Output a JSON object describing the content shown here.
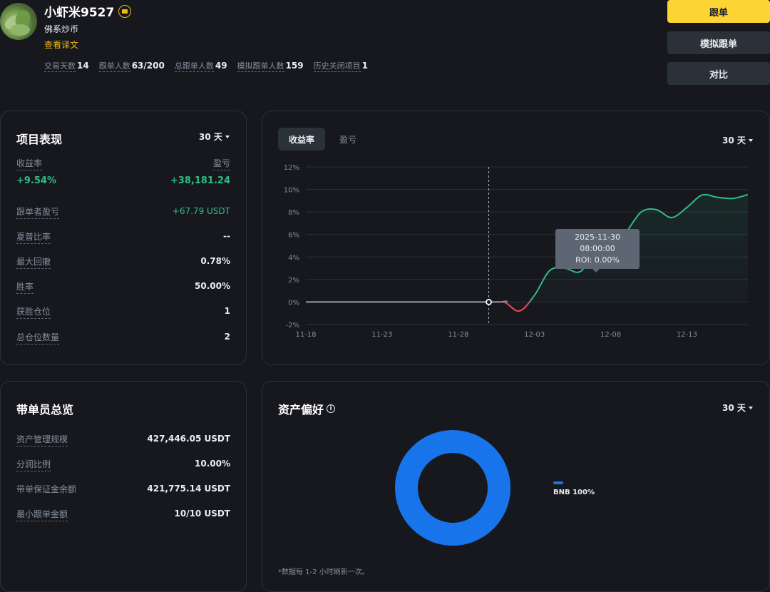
{
  "profile": {
    "name": "小虾米9527",
    "badge_icon": "badge-icon",
    "bio": "佛系炒币",
    "translate_link": "查看译文",
    "stats": [
      {
        "label": "交易天数",
        "value": "14"
      },
      {
        "label": "跟单人数",
        "value": "63/200"
      },
      {
        "label": "总跟单人数",
        "value": "49"
      },
      {
        "label": "模拟跟单人数",
        "value": "159"
      },
      {
        "label": "历史关闭项目",
        "value": "1"
      }
    ]
  },
  "actions": {
    "copy_label": "跟单",
    "mock_copy_label": "模拟跟单",
    "compare_label": "对比"
  },
  "performance": {
    "title": "项目表现",
    "period": "30 天",
    "roi_label": "收益率",
    "pnl_label": "盈亏",
    "roi_value": "+9.54%",
    "pnl_value": "+38,181.24",
    "rows": [
      {
        "label": "跟单者盈亏",
        "value": "+67.79 USDT",
        "color": "#2ebd85"
      },
      {
        "label": "夏普比率",
        "value": "--"
      },
      {
        "label": "最大回撤",
        "value": "0.78%"
      },
      {
        "label": "胜率",
        "value": "50.00%"
      },
      {
        "label": "获胜仓位",
        "value": "1"
      },
      {
        "label": "总仓位数量",
        "value": "2"
      }
    ]
  },
  "chart_panel": {
    "tabs": [
      {
        "label": "收益率",
        "active": true
      },
      {
        "label": "盈亏",
        "active": false
      }
    ],
    "period": "30 天",
    "tooltip": {
      "date": "2025-11-30 08:00:00",
      "roi": "ROI: 0.00%"
    }
  },
  "chart_data": {
    "type": "line",
    "title": "",
    "xlabel": "",
    "ylabel": "",
    "x_ticks": [
      "11-18",
      "11-23",
      "11-28",
      "12-03",
      "12-08",
      "12-13"
    ],
    "y_ticks": [
      "12%",
      "10%",
      "8%",
      "6%",
      "4%",
      "2%",
      "0%",
      "-2%"
    ],
    "ylim": [
      -2,
      12
    ],
    "x_start": "2025-11-18",
    "x_end": "2025-12-17",
    "grid": true,
    "positive_color": "#2ebd85",
    "negative_color": "#f6465d",
    "hover_date": "2025-11-30",
    "series": [
      {
        "x": [
          "2025-11-18",
          "2025-11-30",
          "2025-12-01",
          "2025-12-02",
          "2025-12-03",
          "2025-12-04",
          "2025-12-05",
          "2025-12-06",
          "2025-12-07",
          "2025-12-08",
          "2025-12-09",
          "2025-12-10",
          "2025-12-11",
          "2025-12-12",
          "2025-12-13",
          "2025-12-14",
          "2025-12-15",
          "2025-12-16",
          "2025-12-17"
        ],
        "values": [
          0,
          0,
          0,
          -0.8,
          0.6,
          2.8,
          3.0,
          2.7,
          4.5,
          5.0,
          6.2,
          8.0,
          8.2,
          7.5,
          8.4,
          9.5,
          9.3,
          9.2,
          9.54
        ]
      }
    ]
  },
  "leader": {
    "title": "带单员总览",
    "rows": [
      {
        "label": "资产管理规模",
        "value": "427,446.05 USDT"
      },
      {
        "label": "分润比例",
        "value": "10.00%"
      },
      {
        "label": "带单保证金余额",
        "value": "421,775.14 USDT"
      },
      {
        "label": "最小跟单金额",
        "value": "10/10 USDT"
      }
    ]
  },
  "asset_pref": {
    "title": "资产偏好",
    "info_icon": "info-icon",
    "period": "30 天",
    "legend": [
      {
        "label": "BNB 100%",
        "color": "#1774ea",
        "share": 100
      }
    ],
    "footnote": "*数据每 1-2 小时刷新一次。"
  }
}
